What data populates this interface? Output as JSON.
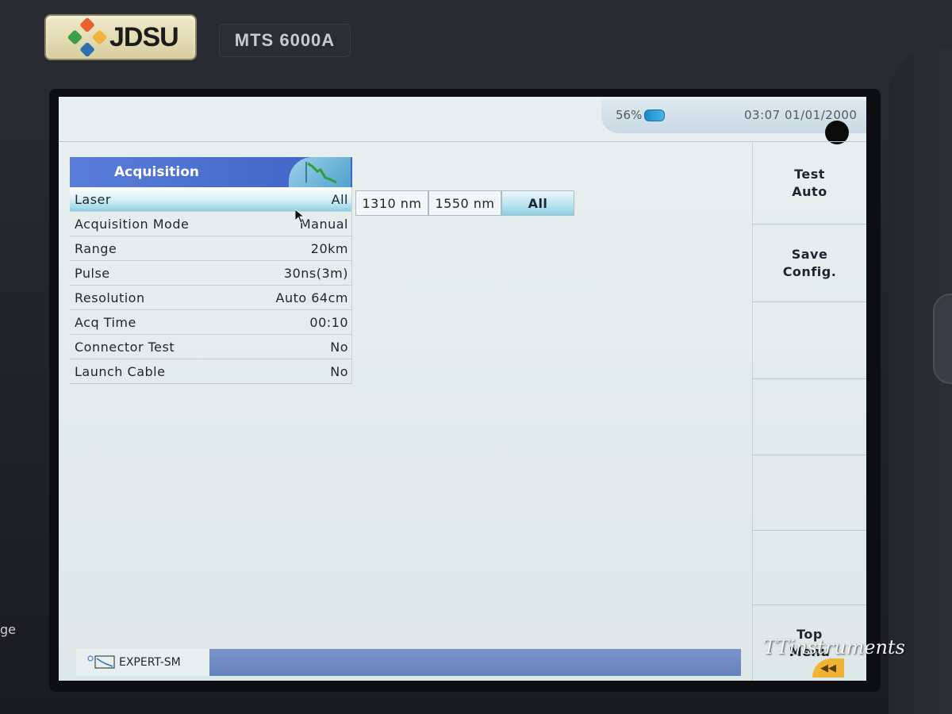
{
  "device": {
    "brand": "JDSU",
    "model": "MTS 6000A",
    "side_label": "ge",
    "watermark": "TTinstruments"
  },
  "status": {
    "battery": "56%",
    "datetime": "03:07  01/01/2000"
  },
  "menu": {
    "title": "Acquisition",
    "rows": [
      {
        "label": "Laser",
        "value": "All"
      },
      {
        "label": "Acquisition Mode",
        "value": "Manual"
      },
      {
        "label": "Range",
        "value": "20km"
      },
      {
        "label": "Pulse",
        "value": "30ns(3m)"
      },
      {
        "label": "Resolution",
        "value": "Auto 64cm"
      },
      {
        "label": "Acq Time",
        "value": "00:10"
      },
      {
        "label": "Connector Test",
        "value": "No"
      },
      {
        "label": "Launch Cable",
        "value": "No"
      }
    ]
  },
  "laser_options": [
    "1310 nm",
    "1550 nm",
    "All"
  ],
  "softkeys": {
    "test_auto": "Test\nAuto",
    "save_config": "Save\nConfig.",
    "top_menu": "Top\nMenu"
  },
  "mode": {
    "label": "EXPERT-SM"
  },
  "colors": {
    "menu_header": "#4a6dcf",
    "selection": "#8fd1e3",
    "bottom_strip": "#6f8ac2"
  }
}
